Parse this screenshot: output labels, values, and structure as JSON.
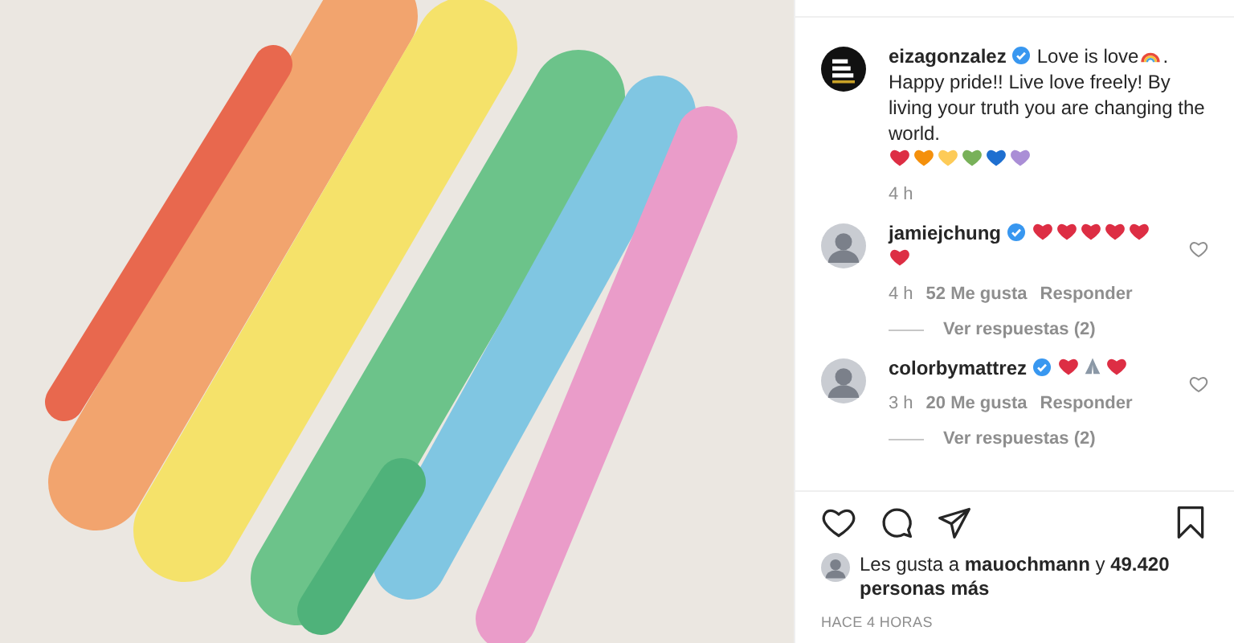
{
  "caption": {
    "username": "eizagonzalez",
    "verified": true,
    "segments": [
      {
        "kind": "text",
        "text": "Love is love"
      },
      {
        "kind": "rainbow"
      },
      {
        "kind": "text",
        "text": "."
      },
      {
        "kind": "paragraph",
        "text": "Happy pride!! Live love freely! By living your truth you are changing the world."
      },
      {
        "kind": "heart",
        "color": "#dd2e44"
      },
      {
        "kind": "heart",
        "color": "#f4900c"
      },
      {
        "kind": "heart",
        "color": "#fdcb58"
      },
      {
        "kind": "heart",
        "color": "#78b159"
      },
      {
        "kind": "heart",
        "color": "#1e6fd0"
      },
      {
        "kind": "heart",
        "color": "#aa8ed6"
      }
    ],
    "time": "4 h"
  },
  "comments": [
    {
      "username": "jamiejchung",
      "verified": true,
      "segments": [
        {
          "kind": "heart",
          "color": "#dd2e44"
        },
        {
          "kind": "heart",
          "color": "#dd2e44"
        },
        {
          "kind": "heart",
          "color": "#dd2e44"
        },
        {
          "kind": "heart",
          "color": "#dd2e44"
        },
        {
          "kind": "heart",
          "color": "#dd2e44"
        },
        {
          "kind": "heart",
          "color": "#dd2e44"
        }
      ],
      "time": "4 h",
      "likes": "52 Me gusta",
      "reply": "Responder",
      "view_replies": "Ver respuestas (2)",
      "liked": false
    },
    {
      "username": "colorbymattrez",
      "verified": true,
      "segments": [
        {
          "kind": "heart",
          "color": "#dd2e44"
        },
        {
          "kind": "pray"
        },
        {
          "kind": "heart",
          "color": "#dd2e44"
        }
      ],
      "time": "3 h",
      "likes": "20 Me gusta",
      "reply": "Responder",
      "view_replies": "Ver respuestas (2)",
      "liked": false
    }
  ],
  "likes_text": "Les gusta a **mauochmann** y **49.420 personas más**",
  "timestamp": "HACE 4 HORAS"
}
